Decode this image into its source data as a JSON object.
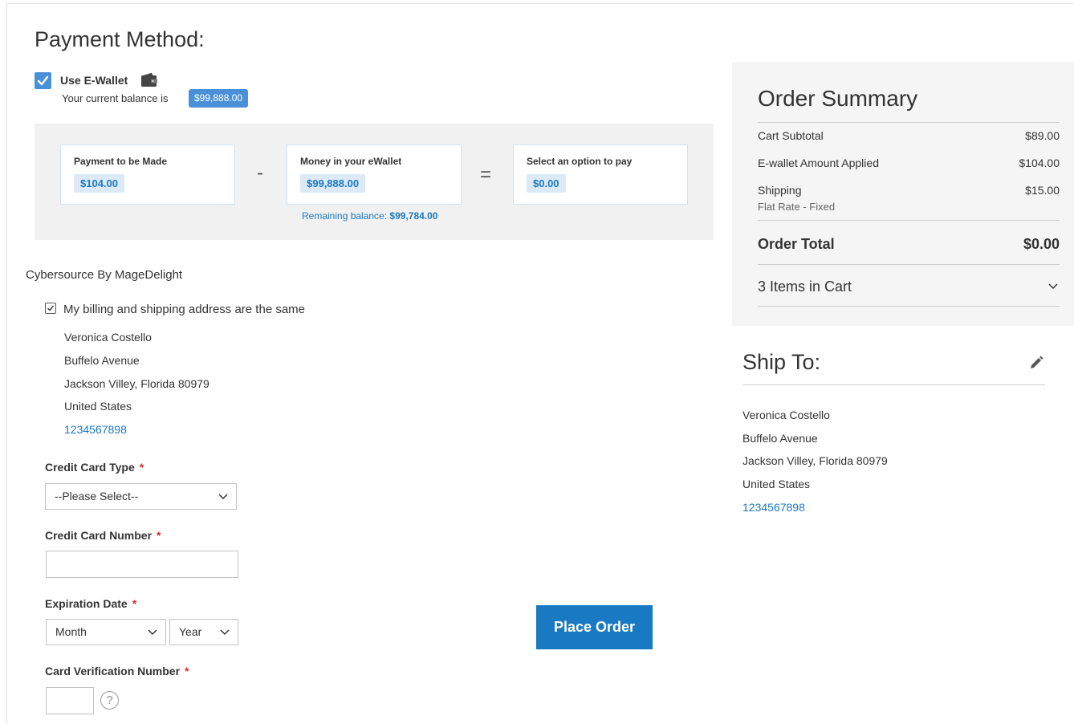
{
  "payment": {
    "title": "Payment Method:",
    "ewallet_label": "Use E-Wallet",
    "ewallet_checked": true,
    "balance_text": "Your current balance is",
    "balance_value": "$99,888.00",
    "calc": {
      "payment_label": "Payment to be Made",
      "payment_value": "$104.00",
      "minus": "-",
      "wallet_label": "Money in your eWallet",
      "wallet_value": "$99,888.00",
      "equals": "=",
      "option_label": "Select an option to pay",
      "option_value": "$0.00",
      "remaining_label": "Remaining balance:",
      "remaining_value": "$99,784.00"
    },
    "method_title": "Cybersource By MageDelight",
    "same_address_label": "My billing and shipping address are the same",
    "same_address_checked": true,
    "address": {
      "name": "Veronica Costello",
      "street": "Buffelo Avenue",
      "city": "Jackson Villey, Florida 80979",
      "country": "United States",
      "phone": "1234567898"
    },
    "cc_type_label": "Credit Card Type",
    "cc_type_value": "--Please Select--",
    "cc_number_label": "Credit Card Number",
    "cc_number_value": "",
    "exp_label": "Expiration Date",
    "exp_month": "Month",
    "exp_year": "Year",
    "cvv_label": "Card Verification Number",
    "cvv_value": "",
    "help_glyph": "?",
    "required_mark": "*",
    "place_order": "Place Order"
  },
  "summary": {
    "title": "Order Summary",
    "rows": [
      {
        "label": "Cart Subtotal",
        "amount": "$89.00"
      },
      {
        "label": "E-wallet Amount Applied",
        "amount": "$104.00"
      },
      {
        "label": "Shipping",
        "amount": "$15.00"
      }
    ],
    "shipping_method": "Flat Rate - Fixed",
    "total_label": "Order Total",
    "total_amount": "$0.00",
    "items_in_cart": "3 Items in Cart"
  },
  "ship_to": {
    "title": "Ship To:",
    "name": "Veronica Costello",
    "street": "Buffelo Avenue",
    "city": "Jackson Villey, Florida 80979",
    "country": "United States",
    "phone": "1234567898"
  },
  "colors": {
    "accent": "#1979c3",
    "checkbox": "#4a90d9",
    "required": "#e02b27",
    "panel": "#f1f1f1",
    "summary_bg": "#f5f5f5"
  },
  "icons": [
    "checkmark-icon",
    "wallet-icon",
    "chevron-down-icon",
    "help-icon",
    "pencil-icon"
  ]
}
